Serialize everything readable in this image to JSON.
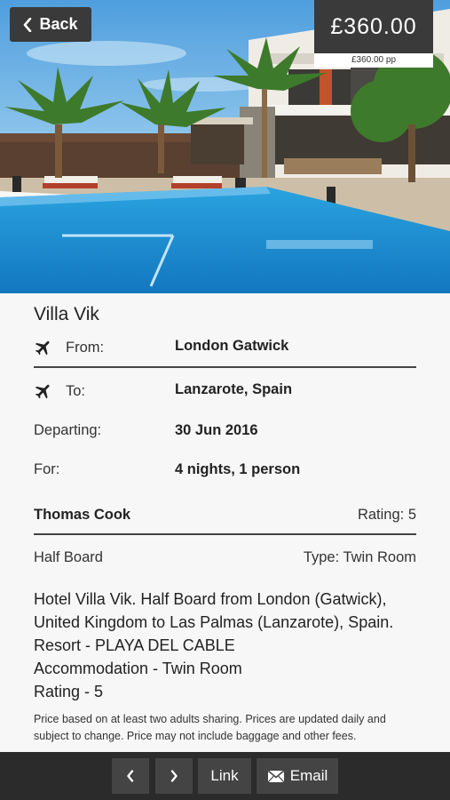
{
  "header": {
    "back_label": "Back",
    "price": "£360.00",
    "price_pp": "£360.00 pp"
  },
  "hotel": {
    "name": "Villa Vik"
  },
  "details": {
    "from_label": "From:",
    "from_value": "London Gatwick",
    "to_label": "To:",
    "to_value": "Lanzarote, Spain",
    "departing_label": "Departing:",
    "departing_value": "30 Jun 2016",
    "for_label": "For:",
    "for_value": "4 nights, 1 person"
  },
  "operator": {
    "name": "Thomas Cook",
    "rating": "Rating: 5"
  },
  "board": {
    "type": "Half Board",
    "room": "Type: Twin Room"
  },
  "description": {
    "lines": [
      "Hotel Villa Vik. Half Board from London (Gatwick),",
      "United Kingdom to Las Palmas (Lanzarote), Spain.",
      "Resort - PLAYA DEL CABLE",
      "Accommodation - Twin Room",
      "Rating - 5"
    ]
  },
  "disclaimer": {
    "line1": "Price based on at least two adults sharing. Prices are updated daily and",
    "line2": "subject to change. Price may not include baggage and other fees."
  },
  "toolbar": {
    "prev_icon": "chevron-left-icon",
    "next_icon": "chevron-right-icon",
    "link_label": "Link",
    "email_label": "Email",
    "email_icon": "envelope-icon"
  },
  "colors": {
    "dark_button": "#3a3a3a",
    "toolbar_bg": "#2b2b2b",
    "pool": "#1e8fd0",
    "sky": "#6fb6e4"
  }
}
